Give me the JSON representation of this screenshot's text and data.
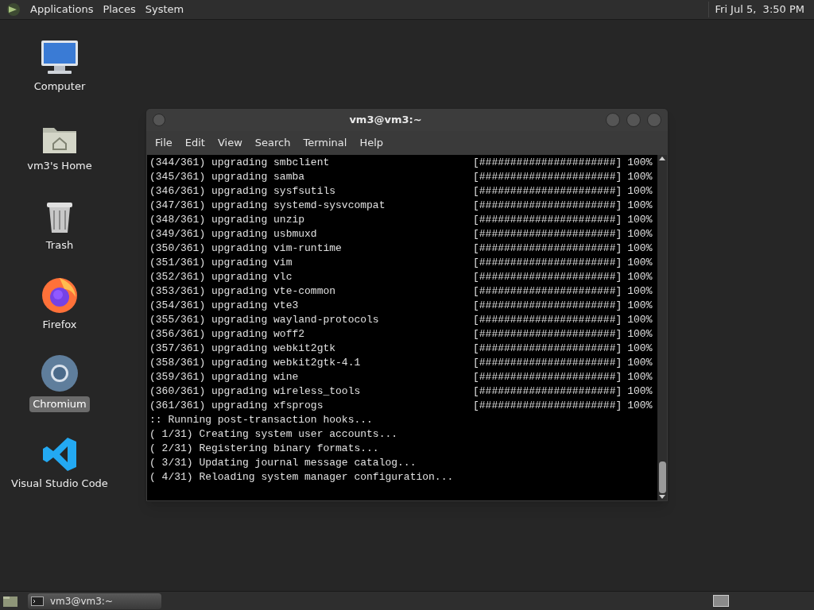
{
  "top_panel": {
    "menus": [
      "Applications",
      "Places",
      "System"
    ],
    "clock": "Fri Jul 5,  3:50 PM"
  },
  "desktop_icons": [
    {
      "kind": "computer",
      "label": "Computer",
      "selected": false
    },
    {
      "kind": "home",
      "label": "vm3's Home",
      "selected": false
    },
    {
      "kind": "trash",
      "label": "Trash",
      "selected": false
    },
    {
      "kind": "firefox",
      "label": "Firefox",
      "selected": false
    },
    {
      "kind": "chromium",
      "label": "Chromium",
      "selected": true
    },
    {
      "kind": "vscode",
      "label": "Visual Studio Code",
      "selected": false
    }
  ],
  "terminal": {
    "title": "vm3@vm3:~",
    "menu": [
      "File",
      "Edit",
      "View",
      "Search",
      "Terminal",
      "Help"
    ],
    "lines": [
      {
        "kind": "progress",
        "text": "(344/361) upgrading smbclient",
        "bar": "[######################]",
        "percent": "100%"
      },
      {
        "kind": "progress",
        "text": "(345/361) upgrading samba",
        "bar": "[######################]",
        "percent": "100%"
      },
      {
        "kind": "progress",
        "text": "(346/361) upgrading sysfsutils",
        "bar": "[######################]",
        "percent": "100%"
      },
      {
        "kind": "progress",
        "text": "(347/361) upgrading systemd-sysvcompat",
        "bar": "[######################]",
        "percent": "100%"
      },
      {
        "kind": "progress",
        "text": "(348/361) upgrading unzip",
        "bar": "[######################]",
        "percent": "100%"
      },
      {
        "kind": "progress",
        "text": "(349/361) upgrading usbmuxd",
        "bar": "[######################]",
        "percent": "100%"
      },
      {
        "kind": "progress",
        "text": "(350/361) upgrading vim-runtime",
        "bar": "[######################]",
        "percent": "100%"
      },
      {
        "kind": "progress",
        "text": "(351/361) upgrading vim",
        "bar": "[######################]",
        "percent": "100%"
      },
      {
        "kind": "progress",
        "text": "(352/361) upgrading vlc",
        "bar": "[######################]",
        "percent": "100%"
      },
      {
        "kind": "progress",
        "text": "(353/361) upgrading vte-common",
        "bar": "[######################]",
        "percent": "100%"
      },
      {
        "kind": "progress",
        "text": "(354/361) upgrading vte3",
        "bar": "[######################]",
        "percent": "100%"
      },
      {
        "kind": "progress",
        "text": "(355/361) upgrading wayland-protocols",
        "bar": "[######################]",
        "percent": "100%"
      },
      {
        "kind": "progress",
        "text": "(356/361) upgrading woff2",
        "bar": "[######################]",
        "percent": "100%"
      },
      {
        "kind": "progress",
        "text": "(357/361) upgrading webkit2gtk",
        "bar": "[######################]",
        "percent": "100%"
      },
      {
        "kind": "progress",
        "text": "(358/361) upgrading webkit2gtk-4.1",
        "bar": "[######################]",
        "percent": "100%"
      },
      {
        "kind": "progress",
        "text": "(359/361) upgrading wine",
        "bar": "[######################]",
        "percent": "100%"
      },
      {
        "kind": "progress",
        "text": "(360/361) upgrading wireless_tools",
        "bar": "[######################]",
        "percent": "100%"
      },
      {
        "kind": "progress",
        "text": "(361/361) upgrading xfsprogs",
        "bar": "[######################]",
        "percent": "100%"
      },
      {
        "kind": "line",
        "text": ":: Running post-transaction hooks..."
      },
      {
        "kind": "line",
        "text": "( 1/31) Creating system user accounts..."
      },
      {
        "kind": "line",
        "text": "( 2/31) Registering binary formats..."
      },
      {
        "kind": "line",
        "text": "( 3/31) Updating journal message catalog..."
      },
      {
        "kind": "line",
        "text": "( 4/31) Reloading system manager configuration..."
      }
    ]
  },
  "taskbar": {
    "windows": [
      {
        "title": "vm3@vm3:~",
        "selected": true
      }
    ]
  }
}
